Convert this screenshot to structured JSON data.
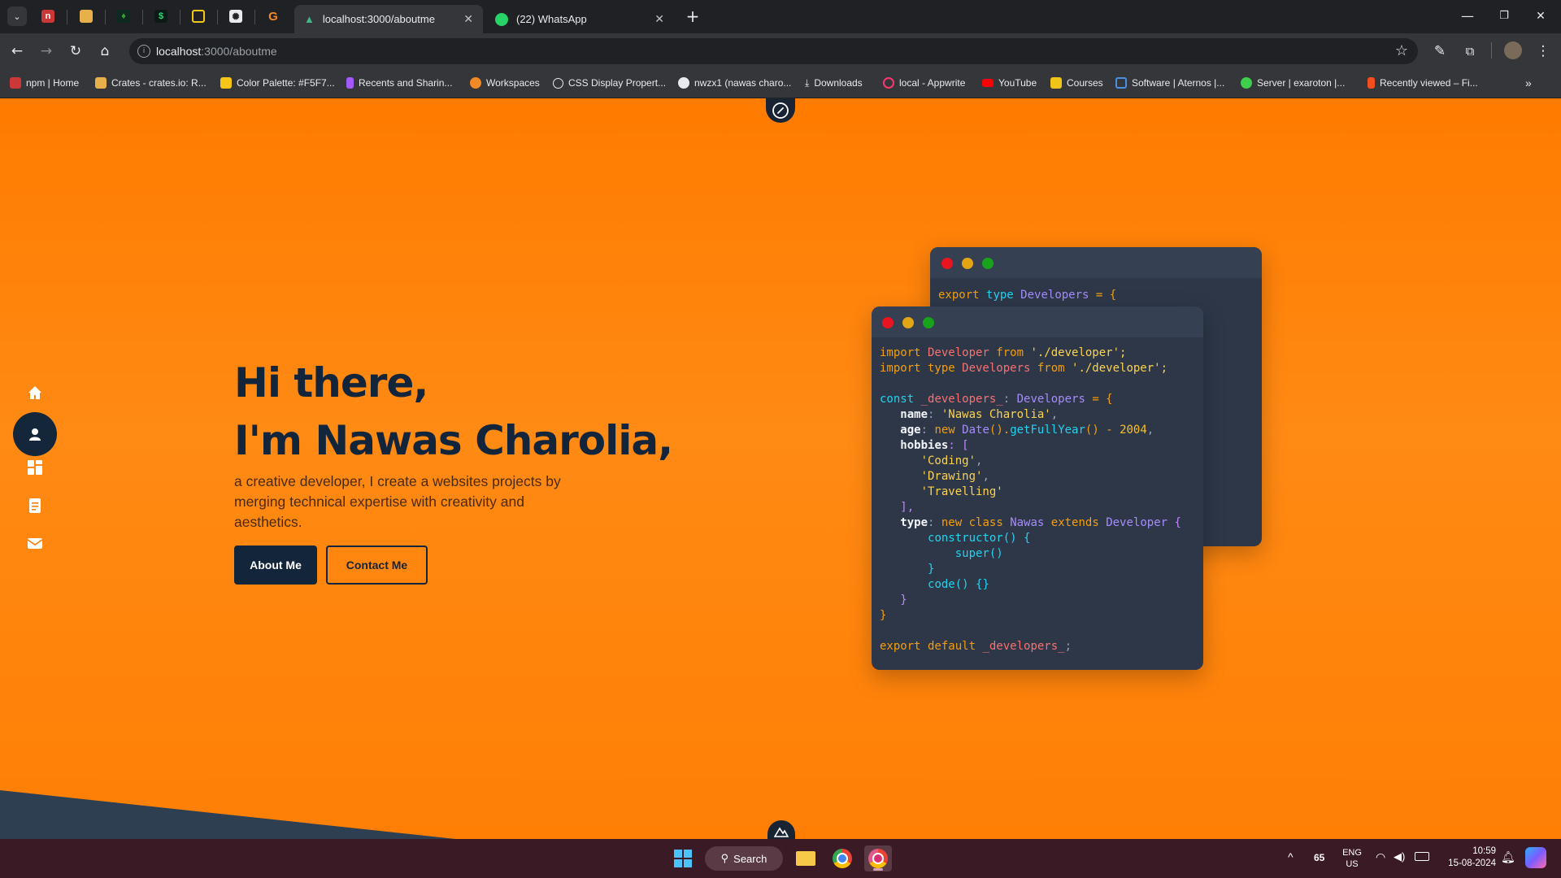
{
  "browser": {
    "tabs": [
      {
        "label": "localhost:3000/aboutme",
        "active": true
      },
      {
        "label": "(22) WhatsApp",
        "active": false
      }
    ],
    "address": {
      "host": "localhost",
      "path": ":3000/aboutme"
    },
    "window_controls": {
      "minimize": "—",
      "restore": "❐",
      "close": "✕"
    },
    "new_tab": "+"
  },
  "bookmarks": [
    {
      "label": "npm | Home",
      "color": "#cb3837"
    },
    {
      "label": "Crates - crates.io: R...",
      "color": "#e8b04a"
    },
    {
      "label": "Color Palette: #F5F7...",
      "color": "#f5c518"
    },
    {
      "label": "Recents and Sharin...",
      "color": "#a259ff"
    },
    {
      "label": "Workspaces",
      "color": "#f08a24"
    },
    {
      "label": "CSS Display Propert...",
      "color": "#e8eaed"
    },
    {
      "label": "nwzx1 (nawas charo...",
      "color": "#e8eaed"
    },
    {
      "label": "Downloads",
      "color": "#e8eaed"
    },
    {
      "label": "local - Appwrite",
      "color": "#fd366e"
    },
    {
      "label": "YouTube",
      "color": "#ff0000"
    },
    {
      "label": "Courses",
      "color": "#f0c419"
    },
    {
      "label": "Software | Aternos |...",
      "color": "#4a90e2"
    },
    {
      "label": "Server | exaroton |...",
      "color": "#3ecf4c"
    },
    {
      "label": "Recently viewed – Fi...",
      "color": "#f24e1e"
    }
  ],
  "hero": {
    "line1": "Hi there,",
    "line2": "I'm Nawas Charolia,",
    "description": "a creative developer, I create a websites projects by merging technical expertise with creativity and aesthetics.",
    "about_button": "About Me",
    "contact_button": "Contact Me"
  },
  "sidebar": [
    "home-icon",
    "user-icon",
    "dashboard-icon",
    "document-icon",
    "mail-icon"
  ],
  "code_back": {
    "line": [
      "export",
      " ",
      "type",
      " ",
      "Developers",
      " = {"
    ]
  },
  "code_front": {
    "l1": [
      "import",
      " Developer ",
      "from",
      " './developer';"
    ],
    "l2": [
      "import type",
      " Developers ",
      "from",
      " './developer';"
    ],
    "l4": [
      "const",
      " _developers_",
      ": ",
      "Developers",
      " = {"
    ],
    "l5": [
      "name",
      ": ",
      "'Nawas Charolia'",
      ","
    ],
    "l6": [
      "age",
      ": ",
      "new",
      " Date",
      "().",
      "getFullYear",
      "() - ",
      "2004",
      ","
    ],
    "l7": [
      "hobbies",
      ": ["
    ],
    "l8": "'Coding'",
    "l9": "'Drawing'",
    "l10": "'Travelling'",
    "l11": "],",
    "l12": [
      "type",
      ": ",
      "new",
      " class ",
      "Nawas",
      " extends ",
      "Developer",
      " {"
    ],
    "l13": "constructor() {",
    "l14": "super()",
    "l15": "}",
    "l16": "code() {}",
    "l17": "}",
    "l18": "}",
    "l20": [
      "export",
      " default ",
      "_developers_",
      ";"
    ]
  },
  "taskbar": {
    "search_label": "Search",
    "tray_number": "65",
    "lang1": "ENG",
    "lang2": "US",
    "time": "10:59",
    "date": "15-08-2024"
  }
}
